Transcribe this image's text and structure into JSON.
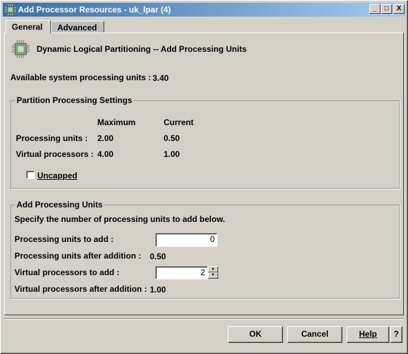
{
  "window": {
    "title": "Add Processor Resources  - uk_lpar (4)",
    "controls": {
      "minimize": "_",
      "maximize": "□",
      "close": "X"
    }
  },
  "tabs": [
    {
      "label": "General",
      "active": true
    },
    {
      "label": "Advanced",
      "active": false
    }
  ],
  "header": {
    "icon": "processor-chip-icon",
    "title": "Dynamic Logical Partitioning -- Add Processing Units"
  },
  "available": {
    "label": "Available system processing units :",
    "value": "3.40"
  },
  "partition_settings": {
    "title": "Partition Processing Settings",
    "col_maximum": "Maximum",
    "col_current": "Current",
    "rows": [
      {
        "label": "Processing units :",
        "maximum": "2.00",
        "current": "0.50"
      },
      {
        "label": "Virtual processors :",
        "maximum": "4.00",
        "current": "1.00"
      }
    ],
    "uncapped_label": "Uncapped",
    "uncapped_checked": false
  },
  "add_units": {
    "title": "Add Processing Units",
    "instruction": "Specify the number of processing units to add below.",
    "proc_units_add_label": "Processing units to add :",
    "proc_units_add_value": "0",
    "proc_units_after_label": "Processing units after addition :",
    "proc_units_after_value": "0.50",
    "virt_proc_add_label": "Virtual processors to add :",
    "virt_proc_add_value": "2",
    "virt_proc_after_label": "Virtual processors after addition :",
    "virt_proc_after_value": "1.00"
  },
  "buttons": {
    "ok": "OK",
    "cancel": "Cancel",
    "help": "Help",
    "question": "?"
  }
}
